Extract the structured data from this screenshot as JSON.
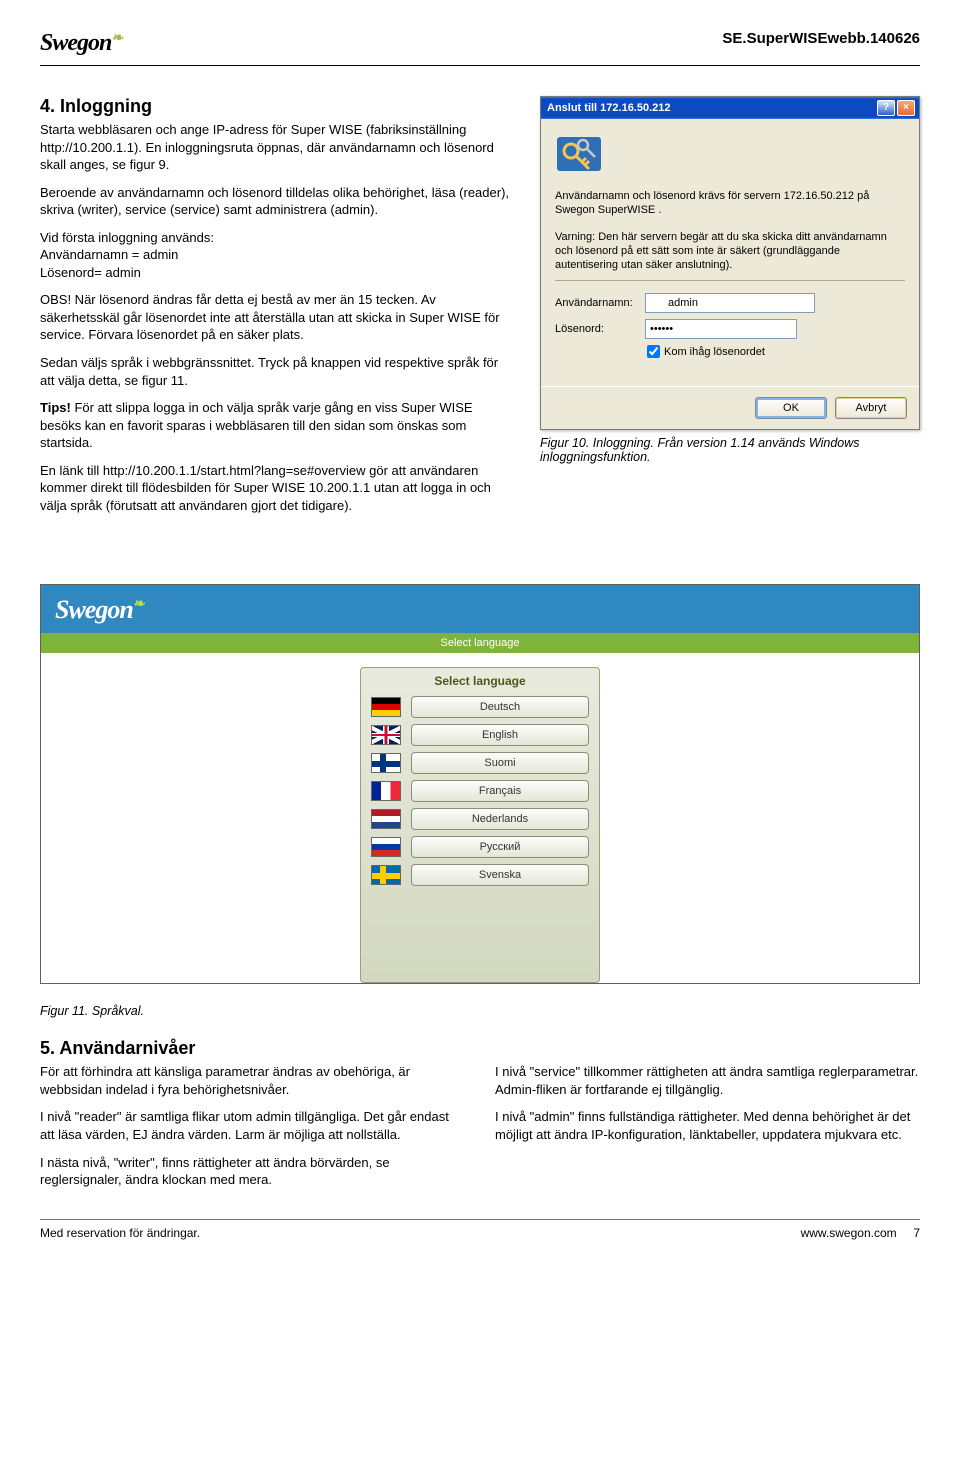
{
  "doc_id": "SE.SuperWISEwebb.140626",
  "logo_text": "Swegon",
  "section4": {
    "heading": "4. Inloggning",
    "p1": "Starta webbläsaren och ange IP-adress för Super WISE (fabriksinställning http://10.200.1.1). En inloggningsruta öppnas, där användarnamn och lösenord skall anges, se figur 9.",
    "p2": "Beroende av användarnamn och lösenord tilldelas olika behörighet, läsa (reader), skriva (writer), service (service) samt administrera (admin).",
    "p3a": "Vid första inloggning används:",
    "p3b": "Användarnamn = admin",
    "p3c": "Lösenord= admin",
    "p4": "OBS! När lösenord ändras får detta ej bestå av mer än 15 tecken. Av säkerhetsskäl går lösenordet inte att återställa utan att skicka in Super WISE för service. Förvara lösenordet på en säker plats.",
    "p5": "Sedan väljs språk i webbgränssnittet. Tryck på knappen vid respektive språk för att välja detta, se figur 11.",
    "p6": "Tips! För att slippa logga in och välja språk varje gång en viss Super WISE besöks kan en favorit sparas i webbläsaren till den sidan som önskas som startsida.",
    "p7": "En länk till http://10.200.1.1/start.html?lang=se#overview gör att användaren kommer direkt till flödesbilden för Super WISE 10.200.1.1 utan att logga in och välja språk (förutsatt att användaren gjort det tidigare)."
  },
  "dialog": {
    "title": "Anslut till 172.16.50.212",
    "msg1": "Användarnamn och lösenord krävs för servern 172.16.50.212 på Swegon SuperWISE .",
    "msg2": "Varning: Den här servern begär att du ska skicka ditt användarnamn och lösenord på ett sätt som inte är säkert (grundläggande autentisering utan säker anslutning).",
    "user_label": "Användarnamn:",
    "user_value": "admin",
    "pass_label": "Lösenord:",
    "pass_value": "••••••",
    "remember": "Kom ihåg lösenordet",
    "ok": "OK",
    "cancel": "Avbryt"
  },
  "fig10": "Figur 10. Inloggning. Från version 1.14 används Windows inloggningsfunktion.",
  "lang_ui": {
    "bar_title": "Select language",
    "panel_title": "Select language",
    "langs": {
      "de": "Deutsch",
      "en": "English",
      "fi": "Suomi",
      "fr": "Français",
      "nl": "Nederlands",
      "ru": "Русский",
      "se": "Svenska"
    }
  },
  "fig11": "Figur 11. Språkval.",
  "section5": {
    "heading": "5. Användarnivåer",
    "left1": "För att förhindra att känsliga parametrar ändras av obehöriga, är webbsidan indelad i fyra behörighetsnivåer.",
    "left2": "I nivå \"reader\" är samtliga flikar utom admin tillgängliga. Det går endast att läsa värden, EJ ändra värden. Larm är möjliga att nollställa.",
    "left3": "I nästa nivå, \"writer\", finns rättigheter att ändra börvärden, se reglersignaler, ändra klockan med mera.",
    "right1": "I nivå \"service\" tillkommer rättigheten att ändra samtliga reglerparametrar. Admin-fliken är fortfarande ej tillgänglig.",
    "right2": "I nivå \"admin\" finns fullständiga rättigheter. Med denna behörighet är det möjligt att ändra IP-konfiguration, länktabeller, uppdatera mjukvara etc."
  },
  "footer": {
    "left": "Med reservation för ändringar.",
    "right_url": "www.swegon.com",
    "page_no": "7"
  }
}
